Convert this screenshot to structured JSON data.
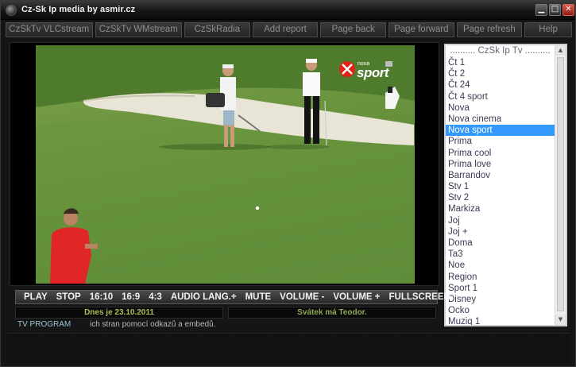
{
  "window": {
    "title": "Cz-Sk Ip media by asmir.cz"
  },
  "menu": {
    "items": [
      "CzSkTv VLCstream",
      "CzSkTv WMstream",
      "CzSkRadia",
      "Add report",
      "Page back",
      "Page forward",
      "Page refresh",
      "Help"
    ]
  },
  "video": {
    "logo_brand": "nova",
    "logo_channel": "sport"
  },
  "channels": {
    "header": ".......... CzSk Ip Tv ..........",
    "items": [
      "Čt 1",
      "Čt 2",
      "Čt 24",
      "Čt 4 sport",
      "Nova",
      "Nova cinema",
      "Nova sport",
      "Prima",
      "Prima cool",
      "Prima love",
      "Barrandov",
      "Stv 1",
      "Stv 2",
      "Markiza",
      "Joj",
      "Joj +",
      "Doma",
      "Ta3",
      "Noe",
      "Region",
      "Sport 1",
      "Disney",
      "Ocko",
      "Muziq 1"
    ],
    "selected": "Nova sport"
  },
  "controls": {
    "play": "PLAY",
    "stop": "STOP",
    "r1610": "16:10",
    "r169": "16:9",
    "r43": "4:3",
    "audio": "AUDIO LANG.+",
    "mute": "MUTE",
    "voldown": "VOLUME -",
    "volup": "VOLUME +",
    "fullscreen": "FULLSCREEN"
  },
  "info": {
    "date": "Dnes je 23.10.2011",
    "holiday": "Svátek má Teodor."
  },
  "tvprogram": {
    "label": "TV PROGRAM",
    "ticker": "ich stran pomocí odkazů a embedů."
  }
}
